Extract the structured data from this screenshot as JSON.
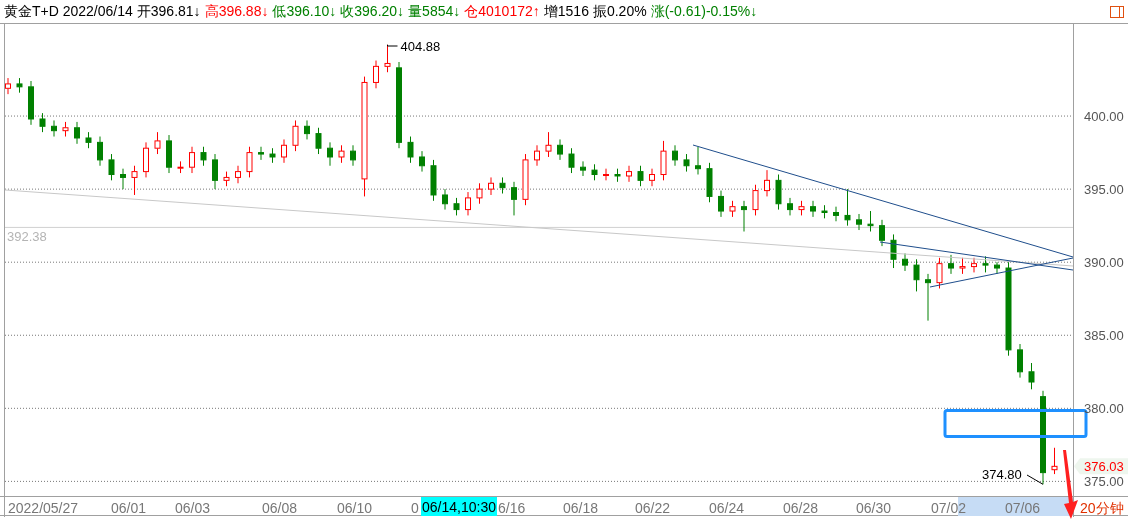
{
  "header": {
    "title": "黄金T+D 2022/06/14",
    "quotes": [
      {
        "text": "开396.81↓",
        "color": "#000000"
      },
      {
        "text": "高396.88↓",
        "color": "#ff0000"
      },
      {
        "text": "低396.10↓",
        "color": "#008000"
      },
      {
        "text": "收396.20↓",
        "color": "#008000"
      },
      {
        "text": "量5854↓",
        "color": "#008000"
      },
      {
        "text": "仓4010172↑",
        "color": "#ff0000"
      },
      {
        "text": "增1516",
        "color": "#000000"
      },
      {
        "text": "振0.20%",
        "color": "#000000"
      },
      {
        "text": "涨(-0.61)-0.15%↓",
        "color": "#008000"
      }
    ]
  },
  "chart": {
    "chart_data": {
      "type": "candlestick",
      "grid": true,
      "ylim": [
        374.0,
        406.3
      ],
      "ref_lines": [
        {
          "axis": "y",
          "value": 392.38,
          "label": "392.38"
        }
      ],
      "yticks": [
        {
          "value": 400,
          "label": "400.00"
        },
        {
          "value": 395,
          "label": "395.00"
        },
        {
          "value": 390,
          "label": "390.00"
        },
        {
          "value": 385,
          "label": "385.00"
        },
        {
          "value": 380,
          "label": "380.00"
        },
        {
          "value": 375,
          "label": "375.00"
        }
      ],
      "ohlc": [
        [
          401.9,
          402.6,
          401.5,
          402.2
        ],
        [
          402.2,
          402.6,
          401.6,
          402.0
        ],
        [
          402.0,
          402.4,
          399.4,
          399.8
        ],
        [
          399.8,
          400.2,
          398.9,
          399.3
        ],
        [
          399.3,
          399.7,
          398.6,
          399.0
        ],
        [
          399.0,
          399.6,
          398.6,
          399.2
        ],
        [
          399.2,
          399.6,
          398.1,
          398.5
        ],
        [
          398.5,
          398.9,
          397.8,
          398.2
        ],
        [
          398.2,
          398.6,
          396.6,
          397.0
        ],
        [
          397.0,
          397.4,
          395.6,
          396.0
        ],
        [
          396.0,
          396.4,
          395.0,
          395.8
        ],
        [
          395.8,
          396.6,
          394.6,
          396.2
        ],
        [
          396.2,
          398.2,
          395.8,
          397.8
        ],
        [
          397.8,
          398.9,
          397.4,
          398.3
        ],
        [
          398.3,
          398.7,
          396.1,
          396.5
        ],
        [
          396.5,
          396.9,
          396.1,
          396.5
        ],
        [
          396.5,
          397.9,
          396.1,
          397.5
        ],
        [
          397.5,
          397.9,
          396.6,
          397.0
        ],
        [
          397.0,
          397.4,
          395.0,
          395.6
        ],
        [
          395.6,
          396.2,
          395.2,
          395.8
        ],
        [
          395.8,
          396.6,
          395.4,
          396.2
        ],
        [
          396.2,
          397.9,
          395.8,
          397.5
        ],
        [
          397.5,
          397.9,
          397.0,
          397.4
        ],
        [
          397.4,
          397.8,
          396.8,
          397.2
        ],
        [
          397.2,
          398.4,
          396.8,
          398.0
        ],
        [
          398.0,
          399.7,
          397.6,
          399.3
        ],
        [
          399.3,
          399.7,
          398.4,
          398.8
        ],
        [
          398.8,
          399.2,
          397.4,
          397.8
        ],
        [
          397.8,
          398.2,
          396.6,
          397.2
        ],
        [
          397.2,
          398.0,
          396.8,
          397.6
        ],
        [
          397.6,
          398.0,
          396.6,
          397.0
        ],
        [
          395.7,
          402.7,
          394.5,
          402.3
        ],
        [
          402.3,
          403.8,
          401.9,
          403.4
        ],
        [
          403.4,
          404.88,
          403.0,
          403.6
        ],
        [
          403.3,
          403.7,
          397.8,
          398.2
        ],
        [
          398.2,
          398.6,
          396.8,
          397.2
        ],
        [
          397.2,
          397.6,
          396.2,
          396.6
        ],
        [
          396.6,
          397.0,
          394.2,
          394.6
        ],
        [
          394.6,
          395.0,
          393.6,
          394.0
        ],
        [
          394.0,
          394.4,
          393.2,
          393.6
        ],
        [
          393.6,
          394.8,
          393.2,
          394.4
        ],
        [
          394.4,
          395.4,
          394.0,
          395.0
        ],
        [
          395.0,
          395.8,
          394.6,
          395.4
        ],
        [
          395.4,
          395.8,
          394.7,
          395.1
        ],
        [
          395.1,
          395.5,
          393.2,
          394.3
        ],
        [
          394.3,
          397.4,
          393.9,
          397.0
        ],
        [
          397.0,
          398.0,
          396.6,
          397.6
        ],
        [
          397.6,
          398.9,
          397.2,
          398.0
        ],
        [
          398.0,
          398.4,
          397.0,
          397.4
        ],
        [
          397.4,
          397.8,
          396.1,
          396.5
        ],
        [
          396.5,
          396.9,
          395.9,
          396.3
        ],
        [
          396.3,
          396.7,
          395.6,
          396.0
        ],
        [
          396.0,
          396.4,
          395.6,
          396.0
        ],
        [
          396.0,
          396.4,
          395.5,
          395.9
        ],
        [
          395.9,
          396.6,
          395.5,
          396.2
        ],
        [
          396.2,
          396.6,
          395.2,
          395.6
        ],
        [
          395.6,
          396.4,
          395.2,
          396.0
        ],
        [
          396.0,
          398.3,
          395.6,
          397.6
        ],
        [
          397.6,
          398.0,
          396.6,
          397.0
        ],
        [
          397.0,
          397.4,
          396.2,
          396.6
        ],
        [
          396.6,
          397.9,
          396.0,
          396.4
        ],
        [
          396.4,
          396.8,
          394.1,
          394.5
        ],
        [
          394.5,
          394.9,
          393.1,
          393.5
        ],
        [
          393.5,
          394.2,
          393.1,
          393.8
        ],
        [
          393.8,
          394.2,
          392.1,
          393.6
        ],
        [
          393.6,
          395.3,
          393.2,
          394.9
        ],
        [
          394.9,
          396.3,
          394.5,
          395.6
        ],
        [
          395.6,
          396.0,
          393.6,
          394.0
        ],
        [
          394.0,
          394.4,
          393.2,
          393.6
        ],
        [
          393.6,
          394.2,
          393.2,
          393.8
        ],
        [
          393.8,
          394.2,
          393.1,
          393.5
        ],
        [
          393.5,
          393.9,
          393.0,
          393.4
        ],
        [
          393.4,
          393.8,
          392.8,
          393.2
        ],
        [
          393.2,
          395.0,
          392.5,
          392.9
        ],
        [
          392.9,
          393.3,
          392.2,
          392.6
        ],
        [
          392.6,
          393.5,
          392.1,
          392.5
        ],
        [
          392.5,
          392.9,
          391.1,
          391.5
        ],
        [
          391.5,
          391.9,
          389.6,
          390.2
        ],
        [
          390.2,
          390.6,
          389.4,
          389.8
        ],
        [
          389.8,
          390.2,
          388.0,
          388.8
        ],
        [
          388.8,
          389.2,
          386.0,
          388.6
        ],
        [
          388.6,
          390.3,
          388.2,
          389.9
        ],
        [
          389.9,
          390.5,
          389.2,
          389.6
        ],
        [
          389.6,
          390.3,
          389.2,
          389.7
        ],
        [
          389.7,
          390.3,
          389.3,
          389.9
        ],
        [
          389.9,
          390.4,
          389.3,
          389.8
        ],
        [
          389.8,
          390.0,
          389.2,
          389.6
        ],
        [
          389.6,
          390.0,
          383.6,
          384.0
        ],
        [
          384.0,
          384.4,
          382.1,
          382.5
        ],
        [
          382.5,
          383.1,
          381.3,
          381.8
        ],
        [
          380.8,
          381.2,
          374.8,
          375.6
        ],
        [
          375.8,
          377.3,
          375.5,
          376.03
        ]
      ],
      "annotations": [
        {
          "text": "404.88"
        },
        {
          "text": "374.80"
        }
      ]
    },
    "last_price": "376.03",
    "x_labels": [
      "2022/05/27",
      "06/01",
      "06/03",
      "06/08",
      "06/10",
      "0",
      "6/16",
      "06/18",
      "06/22",
      "06/24",
      "06/28",
      "06/30",
      "07/02",
      "07/06"
    ],
    "cursor_label": "06/14,10:30",
    "period": "20分钟"
  }
}
